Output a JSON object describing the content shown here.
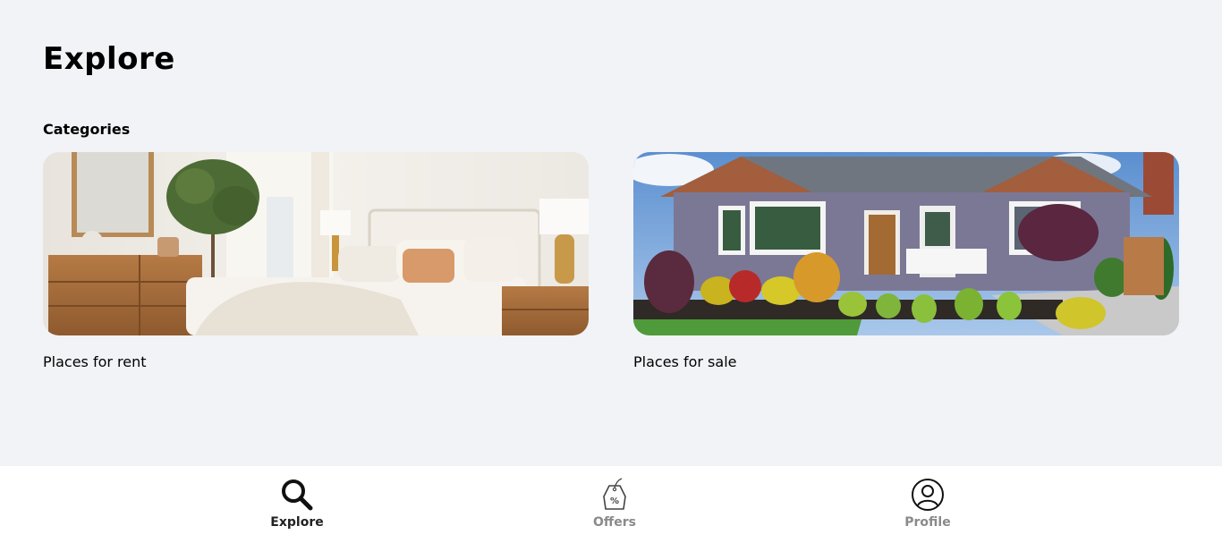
{
  "page": {
    "title": "Explore",
    "section_label": "Categories"
  },
  "categories": [
    {
      "label": "Places for rent",
      "image": "bedroom-photo"
    },
    {
      "label": "Places for sale",
      "image": "house-exterior-photo"
    }
  ],
  "bottom_nav": {
    "items": [
      {
        "label": "Explore",
        "icon": "search-icon",
        "active": true
      },
      {
        "label": "Offers",
        "icon": "offer-tag-icon",
        "active": false
      },
      {
        "label": "Profile",
        "icon": "profile-icon",
        "active": false
      }
    ]
  },
  "colors": {
    "background": "#f2f3f7",
    "nav_background": "#ffffff",
    "active_text": "#222222",
    "inactive_text": "#8a8a8a"
  }
}
